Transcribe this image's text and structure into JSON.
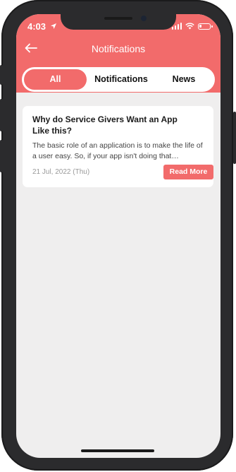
{
  "status_bar": {
    "time": "4:03"
  },
  "header": {
    "title": "Notifications"
  },
  "tabs": [
    {
      "label": "All",
      "active": true
    },
    {
      "label": "Notifications",
      "active": false
    },
    {
      "label": "News",
      "active": false
    }
  ],
  "cards": [
    {
      "title": "Why do Service Givers Want an App Like this?",
      "body": "The basic role of an application is to make the life of a user easy. So, if your app isn't doing that…",
      "date": "21 Jul, 2022 (Thu)",
      "action_label": "Read More"
    }
  ],
  "colors": {
    "accent": "#f26b6b",
    "background": "#efeeee",
    "frame": "#2b2b2d"
  },
  "icons": {
    "back": "arrow-left-icon",
    "location": "location-arrow-icon",
    "signal": "signal-icon",
    "wifi": "wifi-icon",
    "battery": "battery-icon"
  }
}
